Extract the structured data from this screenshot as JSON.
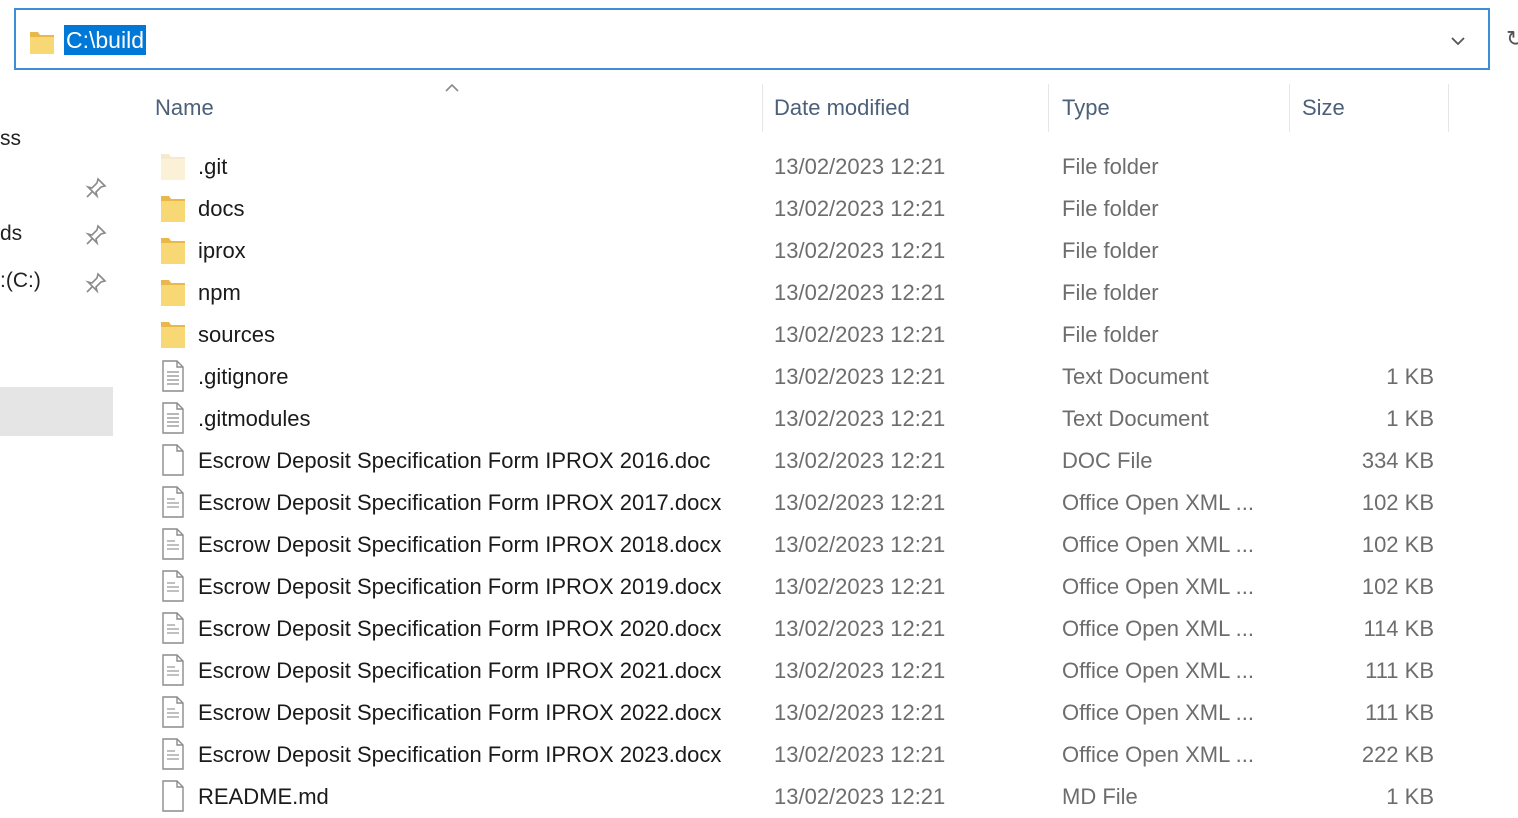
{
  "address_bar": {
    "path": "C:\\build"
  },
  "nav_pane": {
    "items": [
      {
        "label": "ss",
        "pinned": false
      },
      {
        "label": "",
        "pinned": true
      },
      {
        "label": "ds",
        "pinned": true
      },
      {
        "label": ":(C:)",
        "pinned": true
      }
    ]
  },
  "columns": {
    "name": "Name",
    "date": "Date modified",
    "type": "Type",
    "size": "Size",
    "sorted_by": "name",
    "sort_direction": "ascending"
  },
  "files": [
    {
      "name": ".git",
      "date": "13/02/2023 12:21",
      "type": "File folder",
      "size": "",
      "icon": "folder-hidden-icon"
    },
    {
      "name": "docs",
      "date": "13/02/2023 12:21",
      "type": "File folder",
      "size": "",
      "icon": "folder-icon"
    },
    {
      "name": "iprox",
      "date": "13/02/2023 12:21",
      "type": "File folder",
      "size": "",
      "icon": "folder-icon"
    },
    {
      "name": "npm",
      "date": "13/02/2023 12:21",
      "type": "File folder",
      "size": "",
      "icon": "folder-icon"
    },
    {
      "name": "sources",
      "date": "13/02/2023 12:21",
      "type": "File folder",
      "size": "",
      "icon": "folder-icon"
    },
    {
      "name": ".gitignore",
      "date": "13/02/2023 12:21",
      "type": "Text Document",
      "size": "1 KB",
      "icon": "text-file-icon"
    },
    {
      "name": ".gitmodules",
      "date": "13/02/2023 12:21",
      "type": "Text Document",
      "size": "1 KB",
      "icon": "text-file-icon"
    },
    {
      "name": "Escrow Deposit Specification Form IPROX 2016.doc",
      "date": "13/02/2023 12:21",
      "type": "DOC File",
      "size": "334 KB",
      "icon": "blank-file-icon"
    },
    {
      "name": "Escrow Deposit Specification Form IPROX 2017.docx",
      "date": "13/02/2023 12:21",
      "type": "Office Open XML ...",
      "size": "102 KB",
      "icon": "document-file-icon"
    },
    {
      "name": "Escrow Deposit Specification Form IPROX 2018.docx",
      "date": "13/02/2023 12:21",
      "type": "Office Open XML ...",
      "size": "102 KB",
      "icon": "document-file-icon"
    },
    {
      "name": "Escrow Deposit Specification Form IPROX 2019.docx",
      "date": "13/02/2023 12:21",
      "type": "Office Open XML ...",
      "size": "102 KB",
      "icon": "document-file-icon"
    },
    {
      "name": "Escrow Deposit Specification Form IPROX 2020.docx",
      "date": "13/02/2023 12:21",
      "type": "Office Open XML ...",
      "size": "114 KB",
      "icon": "document-file-icon"
    },
    {
      "name": "Escrow Deposit Specification Form IPROX 2021.docx",
      "date": "13/02/2023 12:21",
      "type": "Office Open XML ...",
      "size": "111 KB",
      "icon": "document-file-icon"
    },
    {
      "name": "Escrow Deposit Specification Form IPROX 2022.docx",
      "date": "13/02/2023 12:21",
      "type": "Office Open XML ...",
      "size": "111 KB",
      "icon": "document-file-icon"
    },
    {
      "name": "Escrow Deposit Specification Form IPROX 2023.docx",
      "date": "13/02/2023 12:21",
      "type": "Office Open XML ...",
      "size": "222 KB",
      "icon": "document-file-icon"
    },
    {
      "name": "README.md",
      "date": "13/02/2023 12:21",
      "type": "MD File",
      "size": "1 KB",
      "icon": "blank-file-icon"
    }
  ],
  "colors": {
    "accent": "#0078d7",
    "address_border": "#3c8fd6",
    "folder": "#f8d775",
    "header_text": "#4c607a",
    "secondary_text": "#6d6d6d",
    "nav_selected": "#e5e5e5"
  }
}
